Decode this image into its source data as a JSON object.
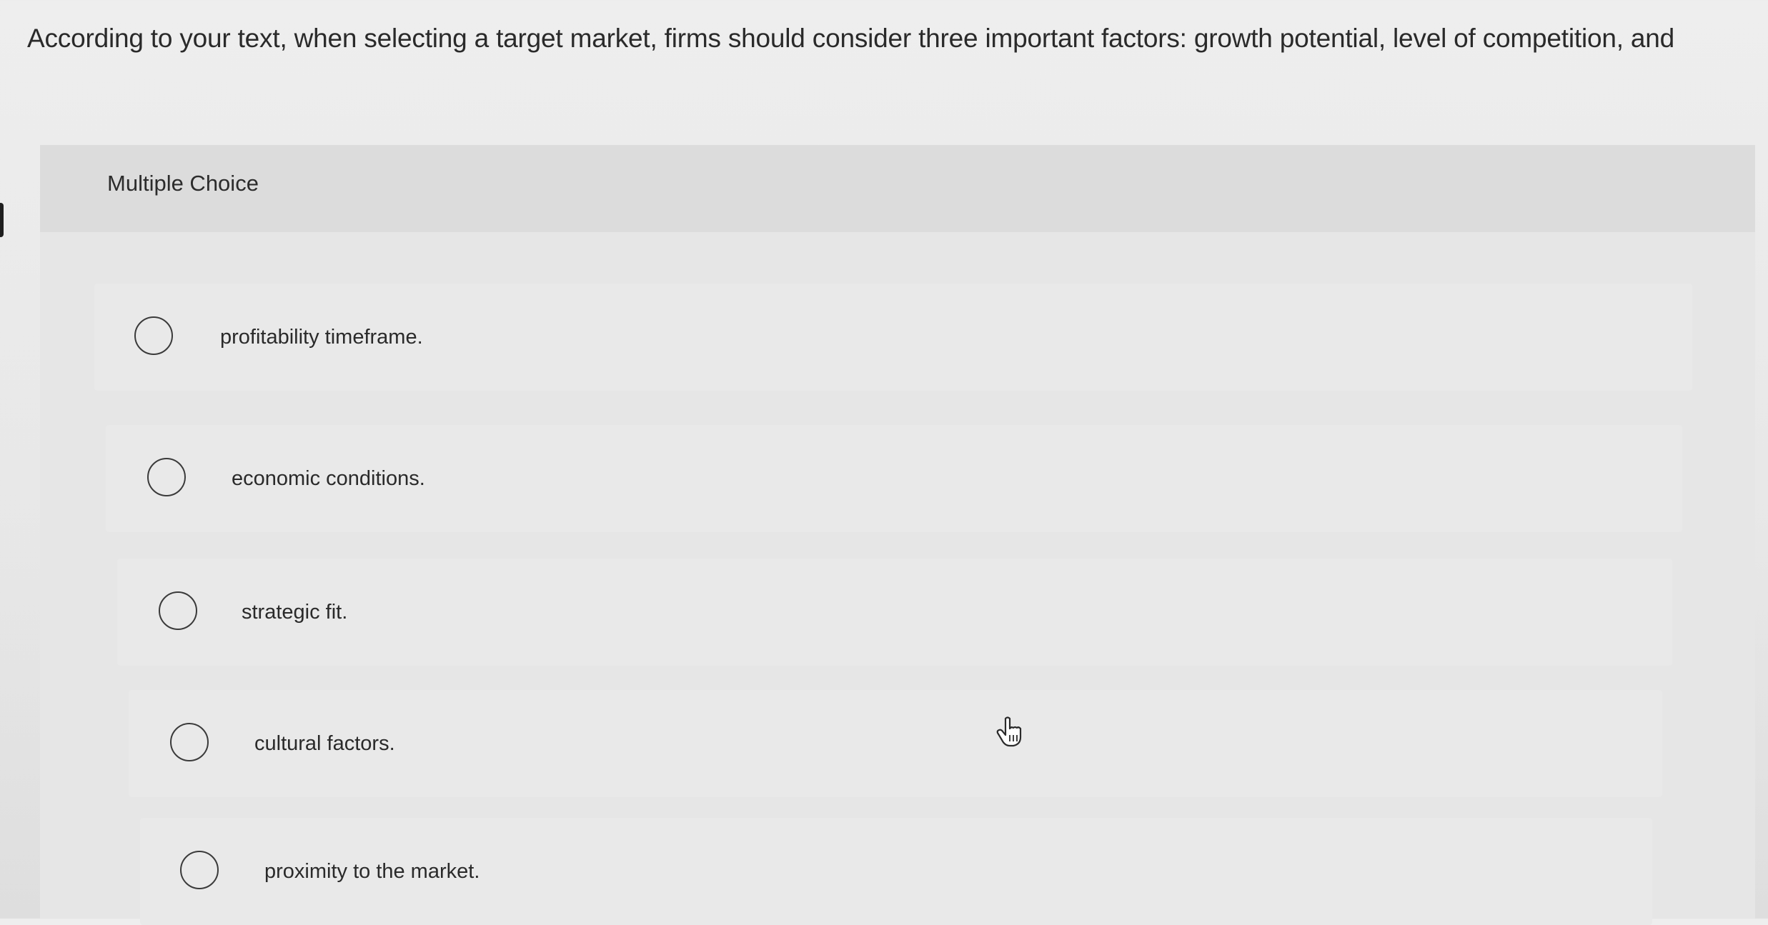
{
  "question": {
    "text": "According to your text, when selecting a target market, firms should consider three important factors: growth potential, level of competition, and"
  },
  "panel": {
    "label": "Multiple Choice"
  },
  "choices": [
    {
      "label": "profitability timeframe."
    },
    {
      "label": "economic conditions."
    },
    {
      "label": "strategic fit."
    },
    {
      "label": "cultural factors."
    },
    {
      "label": "proximity to the market."
    }
  ],
  "icons": {
    "cursor": "hand-pointer-icon",
    "radio": "radio-empty-icon"
  },
  "colors": {
    "background": "#e9e9e9",
    "panel": "#e2e2e2",
    "text": "#2a2a2a"
  }
}
